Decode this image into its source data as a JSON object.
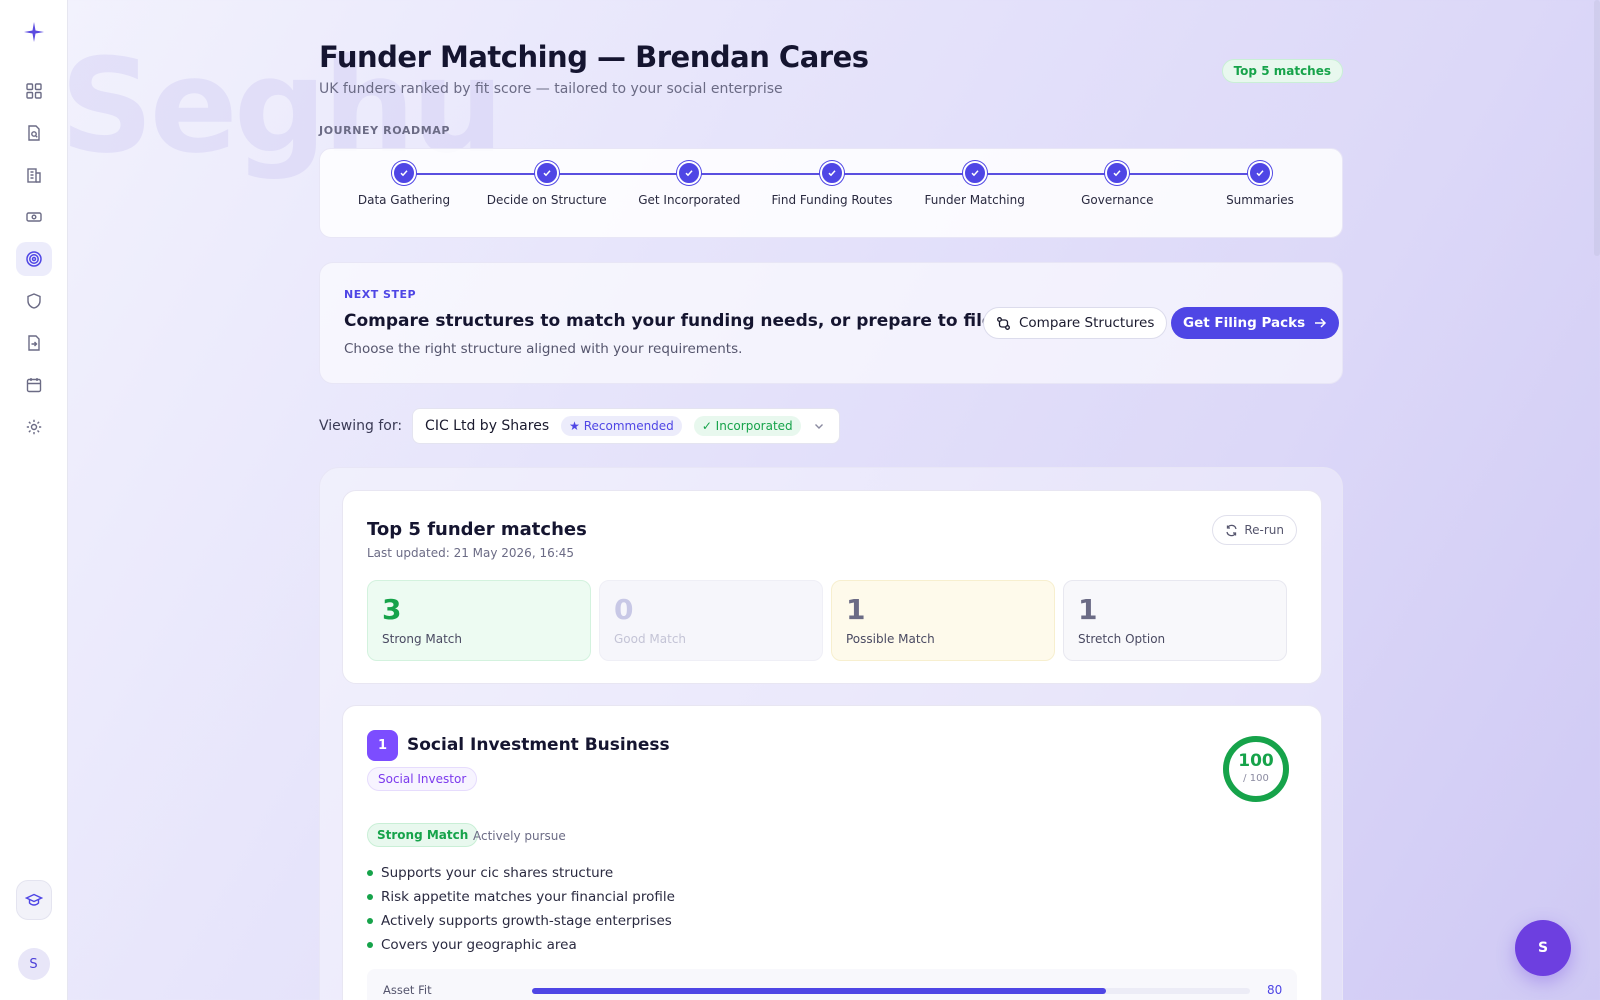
{
  "app": {
    "watermark": "Seghu"
  },
  "header": {
    "title": "Funder Matching — Brendan Cares",
    "subtitle": "UK funders ranked by fit score — tailored to your social enterprise",
    "badge": "Top 5 matches"
  },
  "roadmap": {
    "label": "JOURNEY ROADMAP",
    "steps": [
      {
        "name": "Data Gathering",
        "status": "complete"
      },
      {
        "name": "Decide on Structure",
        "status": "complete"
      },
      {
        "name": "Get Incorporated",
        "status": "complete"
      },
      {
        "name": "Find Funding Routes",
        "status": "complete"
      },
      {
        "name": "Funder Matching",
        "status": "complete"
      },
      {
        "name": "Governance",
        "status": "complete"
      },
      {
        "name": "Summaries",
        "status": "complete"
      }
    ]
  },
  "next_step": {
    "label": "NEXT STEP",
    "title": "Compare structures to match your funding needs, or prepare to file",
    "description": "Choose the right structure aligned with your requirements.",
    "compare_button": "Compare Structures",
    "filing_button": "Get Filing Packs"
  },
  "viewing": {
    "label": "Viewing for:",
    "value": "CIC Ltd by Shares",
    "recommended": "★ Recommended",
    "incorporated": "✓ Incorporated"
  },
  "summary": {
    "title": "Top 5 funder matches",
    "updated": "Last updated: 21 May 2026, 16:45",
    "rerun": "Re-run",
    "stats": [
      {
        "value": "3",
        "label": "Strong Match"
      },
      {
        "value": "0",
        "label": "Good Match"
      },
      {
        "value": "1",
        "label": "Possible Match"
      },
      {
        "value": "1",
        "label": "Stretch Option"
      }
    ]
  },
  "match": {
    "rank": "1",
    "name": "Social Investment Business",
    "type": "Social Investor",
    "score": "100",
    "score_of": "/ 100",
    "score_fraction": 1.0,
    "strength": "Strong Match",
    "strength_note": "Actively pursue",
    "reasons": [
      "Supports your cic shares structure",
      "Risk appetite matches your financial profile",
      "Actively supports growth-stage enterprises",
      "Covers your geographic area"
    ],
    "asset_fit": {
      "label": "Asset Fit",
      "value": "80",
      "fraction": 0.8
    }
  },
  "user": {
    "initial": "S"
  },
  "colors": {
    "accent": "#4f46e5",
    "strong": "#16a34a",
    "purple": "#7c4dff"
  }
}
